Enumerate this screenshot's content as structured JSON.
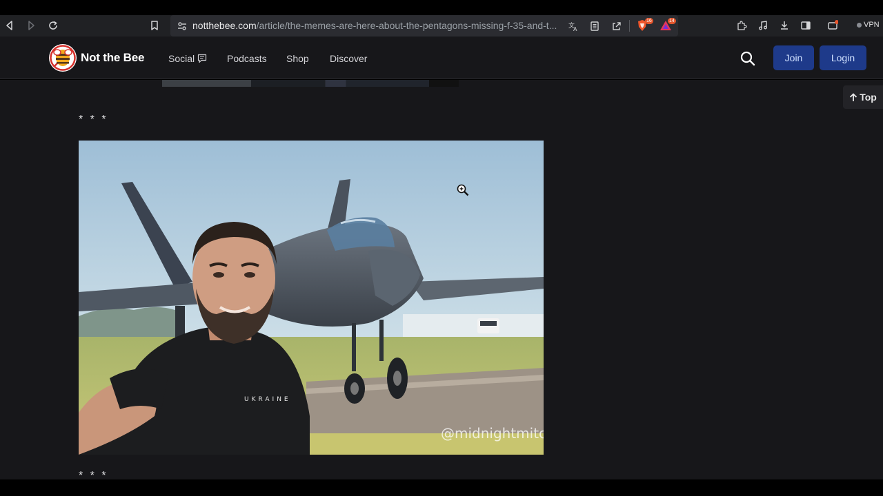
{
  "browser": {
    "url_domain": "notthebee.com",
    "url_path": "/article/the-memes-are-here-about-the-pentagons-missing-f-35-and-t...",
    "shield_count": "16",
    "alert_count": "14",
    "vpn_label": "VPN"
  },
  "site": {
    "brand": "Not the Bee",
    "nav": [
      {
        "label": "Social"
      },
      {
        "label": "Podcasts"
      },
      {
        "label": "Shop"
      },
      {
        "label": "Discover"
      }
    ],
    "join_label": "Join",
    "login_label": "Login"
  },
  "article": {
    "separator_top": "* * *",
    "separator_bottom": "* * *",
    "image_watermark": "@midnightmitc",
    "shirt_text": "UKRAINE",
    "top_label": "Top"
  },
  "colors": {
    "header_bg": "#17171a",
    "button_bg": "#1e3a8a",
    "logo_red": "#d6322d"
  }
}
